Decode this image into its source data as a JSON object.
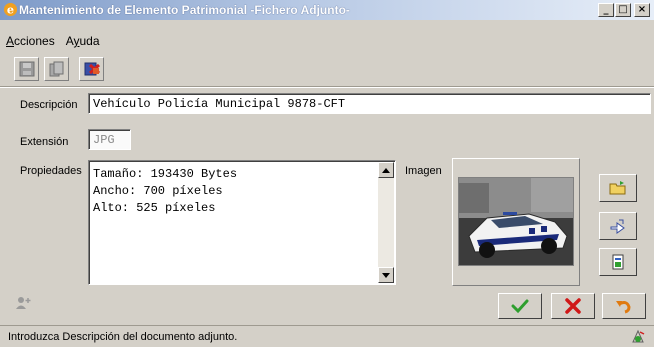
{
  "window": {
    "title": "Mantenimiento de Elemento Patrimonial -Fichero Adjunto-",
    "minimize_glyph": "_",
    "maximize_glyph": "□",
    "close_glyph": "×"
  },
  "menu": {
    "acciones": {
      "underlined": "A",
      "rest": "cciones"
    },
    "ayuda": {
      "before": "A",
      "underlined": "y",
      "after": "uda"
    }
  },
  "toolbar": {
    "icons": [
      "save-icon",
      "copy-icon",
      "delete-icon"
    ]
  },
  "form": {
    "descripcion_label": "Descripción",
    "descripcion_value": "Vehículo Policía Municipal 9878-CFT",
    "extension_label": "Extensión",
    "extension_value": "JPG",
    "propiedades_label": "Propiedades",
    "propiedades_lines": [
      "Tamaño: 193430 Bytes",
      "Ancho: 700 píxeles",
      "Alto: 525 píxeles"
    ],
    "imagen_label": "Imagen"
  },
  "side_buttons": [
    "open-folder-icon",
    "export-icon",
    "document-icon"
  ],
  "actions": [
    "accept-icon",
    "cancel-icon",
    "undo-icon"
  ],
  "status": {
    "text": "Introduzca Descripción del documento adjunto."
  },
  "colors": {
    "title_gradient_start": "#7d9ac8",
    "title_gradient_end": "#e7eef8",
    "window_bg": "#d4d0c8",
    "accept_green": "#2e9e2e",
    "cancel_red": "#d01818",
    "undo_orange": "#e07a10"
  }
}
